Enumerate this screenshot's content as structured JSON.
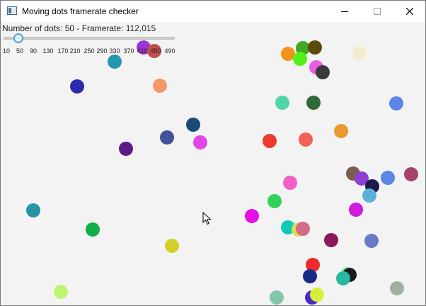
{
  "window": {
    "title": "Moving dots framerate checker",
    "icon": "app-window-icon",
    "controls": [
      "minimize-icon",
      "maximize-icon",
      "close-icon"
    ]
  },
  "status": {
    "text": "Number of dots: 50 - Framerate: 112,015",
    "dot_count": 50,
    "framerate": "112,015"
  },
  "slider": {
    "min": 10,
    "max": 490,
    "value": 50,
    "ticks": [
      "10",
      "50",
      "90",
      "130",
      "170",
      "210",
      "250",
      "290",
      "330",
      "370",
      "410",
      "450",
      "490"
    ]
  },
  "dots": [
    {
      "color": "#9b34d6"
    },
    {
      "color": "#c0504d"
    },
    {
      "color": "#2397b0"
    },
    {
      "color": "#2a2ab0"
    },
    {
      "color": "#f4976c"
    },
    {
      "color": "#f29418"
    },
    {
      "color": "#3fa826"
    },
    {
      "color": "#5e4a08"
    },
    {
      "color": "#54f01a"
    },
    {
      "color": "#e85ee0"
    },
    {
      "color": "#3a3a3a"
    },
    {
      "color": "#f5ecd0"
    },
    {
      "color": "#4fd6a6"
    },
    {
      "color": "#2f6a38"
    },
    {
      "color": "#5b86e6"
    },
    {
      "color": "#1a4a78"
    },
    {
      "color": "#43509a"
    },
    {
      "color": "#e146e6"
    },
    {
      "color": "#5c1a88"
    },
    {
      "color": "#ee3a2a"
    },
    {
      "color": "#f26156"
    },
    {
      "color": "#ea9a2e"
    },
    {
      "color": "#7b5e52"
    },
    {
      "color": "#8e3ed2"
    },
    {
      "color": "#5b86e6"
    },
    {
      "color": "#a8426a"
    },
    {
      "color": "#1a1a4a"
    },
    {
      "color": "#5ab0d8"
    },
    {
      "color": "#f060c8"
    },
    {
      "color": "#35d05a"
    },
    {
      "color": "#2894a8"
    },
    {
      "color": "#e80ee8"
    },
    {
      "color": "#d01adc"
    },
    {
      "color": "#10b048"
    },
    {
      "color": "#12c8b8"
    },
    {
      "color": "#dcdc52"
    },
    {
      "color": "#d46a86"
    },
    {
      "color": "#8a1a5a"
    },
    {
      "color": "#6a7ac8"
    },
    {
      "color": "#d6ce28"
    },
    {
      "color": "#ee2a2a"
    },
    {
      "color": "#1a2a88"
    },
    {
      "color": "#8ee89e"
    },
    {
      "color": "#1a1a1a"
    },
    {
      "color": "#26b8a0"
    },
    {
      "color": "#baf670"
    },
    {
      "color": "#86c4a8"
    },
    {
      "color": "#4a2ac8"
    },
    {
      "color": "#d8ee3a"
    },
    {
      "color": "#a0b0a0"
    }
  ]
}
